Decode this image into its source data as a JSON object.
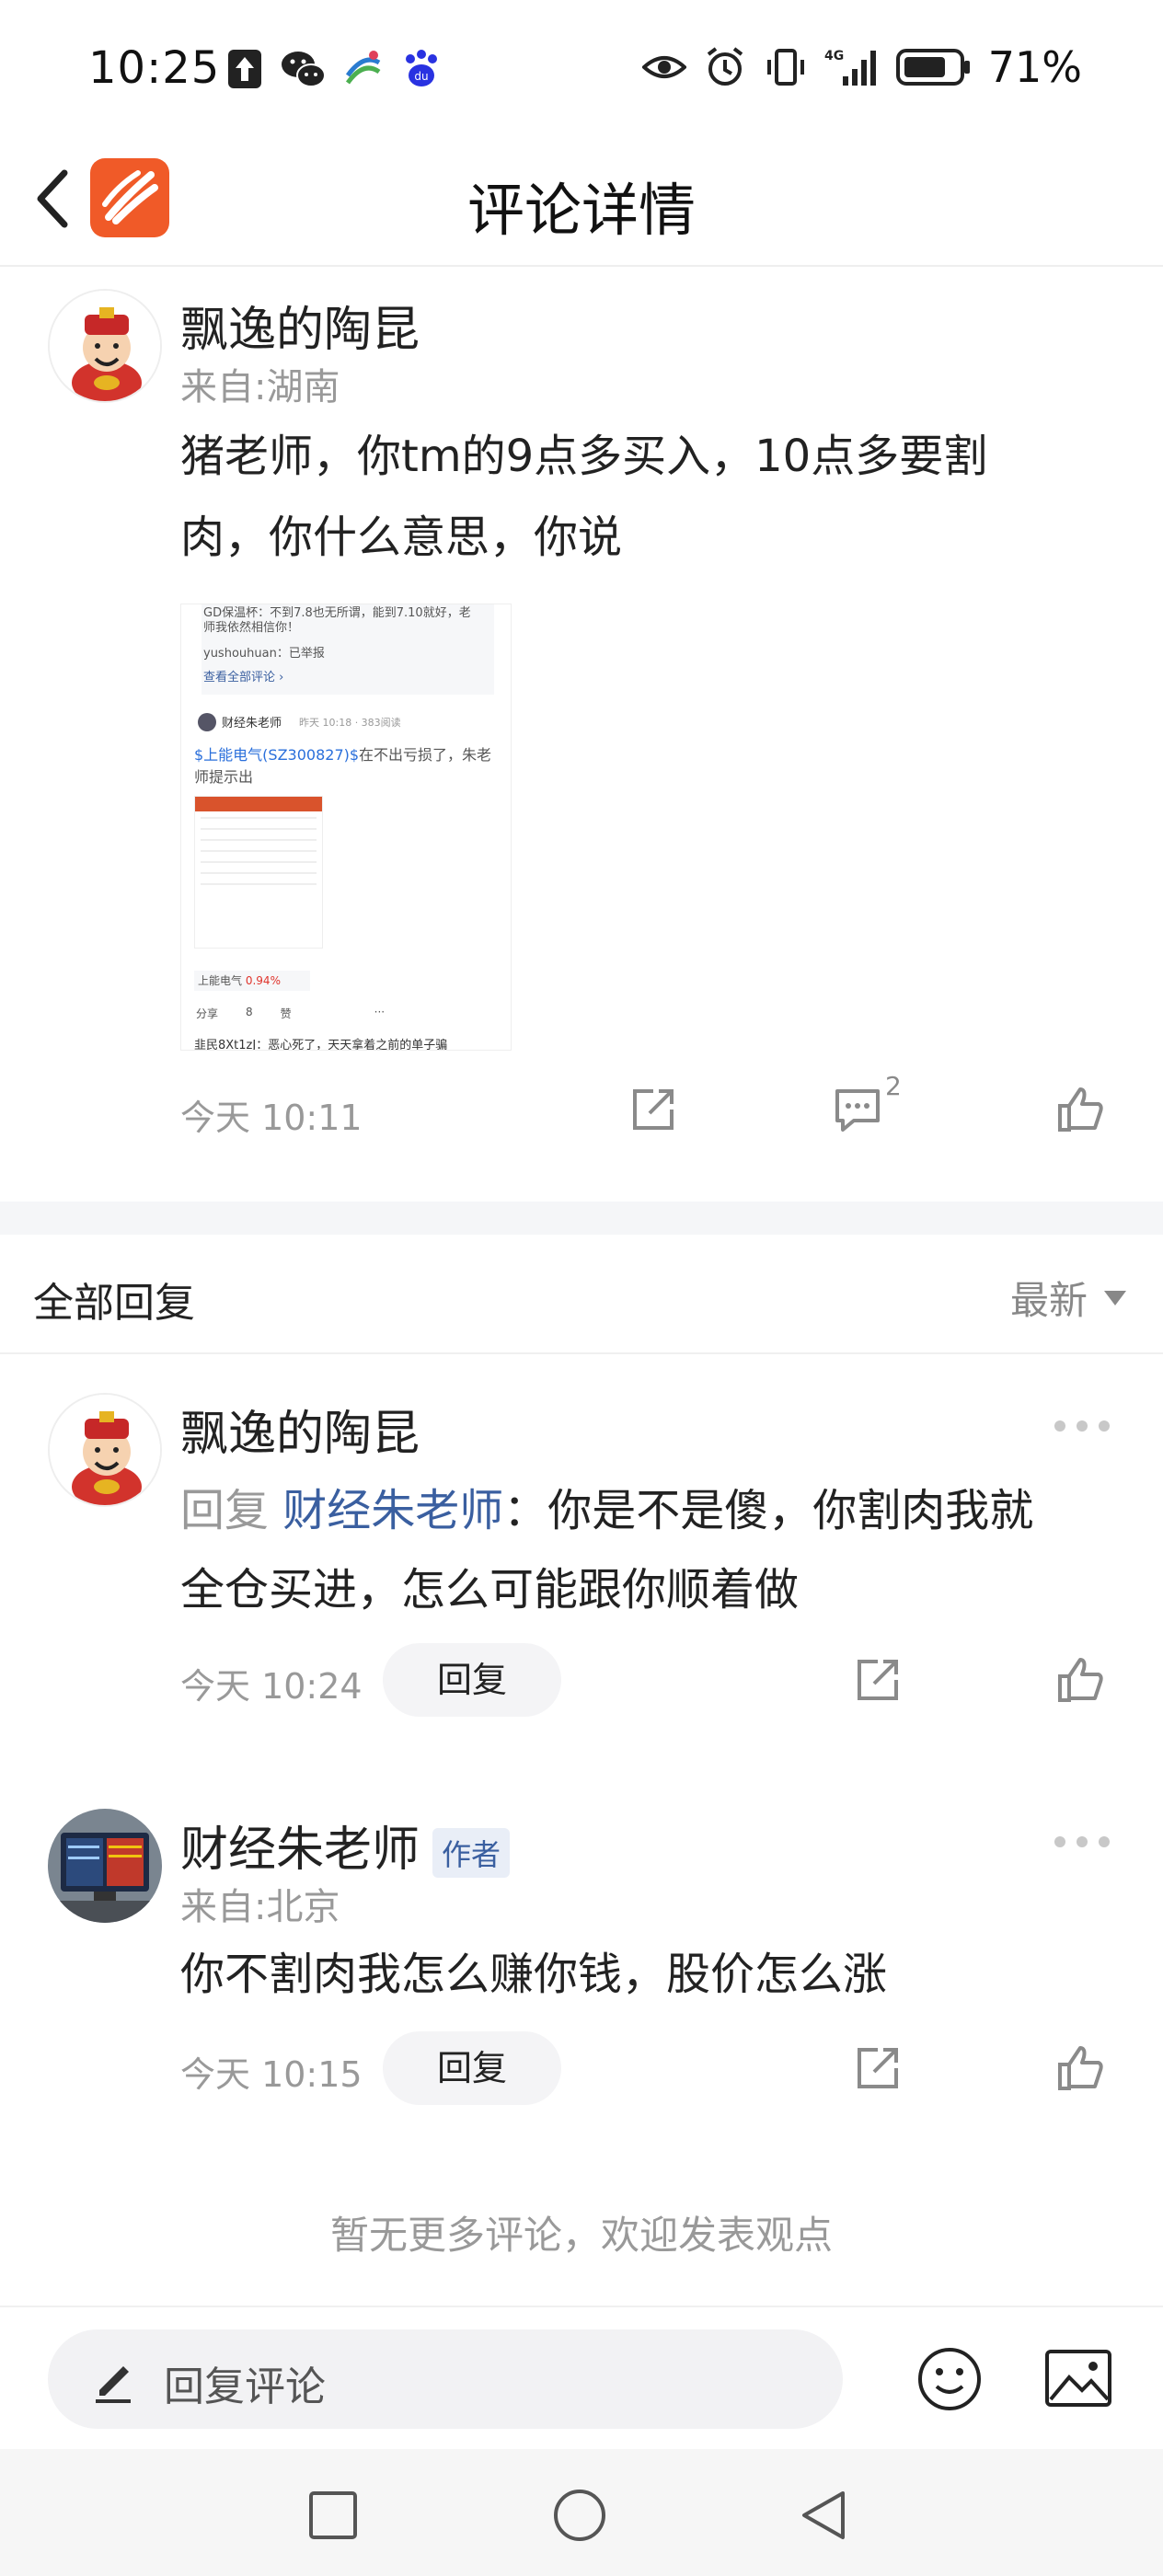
{
  "status_bar": {
    "time": "10:25",
    "network": "4G",
    "battery_pct": "71%"
  },
  "header": {
    "title": "评论详情"
  },
  "main_comment": {
    "username": "飘逸的陶昆",
    "location": "来自:湖南",
    "text_line1": "猪老师，你tm的9点多买入，10点多要割",
    "text_line2": "肉，你什么意思，你说",
    "time": "今天 10:11",
    "comment_count": "2",
    "embedded_screenshot": {
      "top_text1": "GD保温杯：不到7.8也无所谓，能到7.10就好，老",
      "top_text2": "师我依然相信你！",
      "reply_user": "yushouhuan：已举报",
      "view_all": "查看全部评论 ›",
      "author": "财经朱老师",
      "meta": "昨天 10:18 · 383阅读",
      "stock_link": "$上能电气(SZ300827)$",
      "post_text1": "在不出亏损了，朱老",
      "post_text2": "师提示出",
      "stock_name": "上能电气",
      "stock_change": "0.94%",
      "share": "分享",
      "comments": "8",
      "likes": "赞",
      "bottom_text": "韭民8Xt1zJ：恶心死了，天天拿着之前的单子骗"
    }
  },
  "replies_section": {
    "title": "全部回复",
    "sort_label": "最新"
  },
  "replies": [
    {
      "username": "飘逸的陶昆",
      "reply_prefix": "回复",
      "reply_target": "财经朱老师",
      "text_line1": "：你是不是傻，你割肉我就",
      "text_line2": "全仓买进，怎么可能跟你顺着做",
      "time": "今天 10:24",
      "reply_button": "回复"
    },
    {
      "username": "财经朱老师",
      "badge": "作者",
      "location": "来自:北京",
      "text": "你不割肉我怎么赚你钱，股价怎么涨",
      "time": "今天 10:15",
      "reply_button": "回复"
    }
  ],
  "footer_note": "暂无更多评论，欢迎发表观点",
  "input": {
    "placeholder": "回复评论"
  },
  "colors": {
    "accent_link": "#3a5fa0",
    "app_logo": "#f05a28",
    "muted_text": "#999999"
  }
}
